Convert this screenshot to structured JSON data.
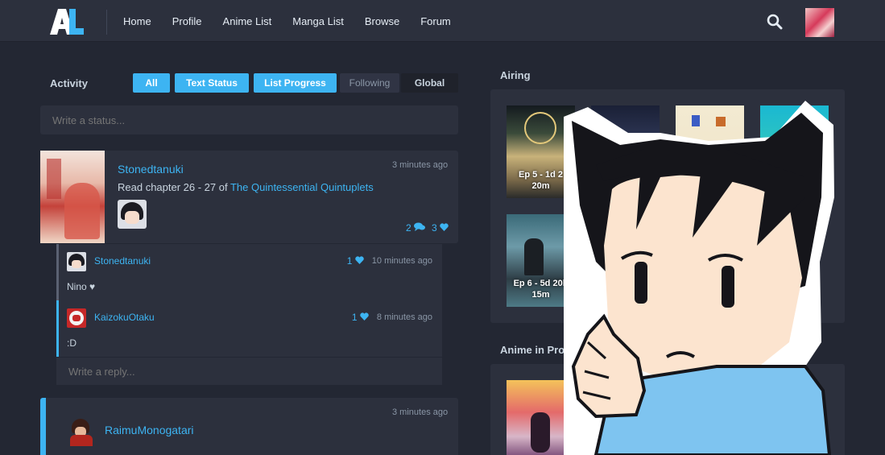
{
  "nav": {
    "logo_text": "AL",
    "links": [
      "Home",
      "Profile",
      "Anime List",
      "Manga List",
      "Browse",
      "Forum"
    ],
    "search_icon": "search-icon",
    "avatar_icon": "avatar"
  },
  "feed": {
    "title": "Activity",
    "filters": [
      "All",
      "Text Status",
      "List Progress",
      "Following",
      "Global"
    ],
    "status_placeholder": "Write a status...",
    "activity": {
      "user": "Stonedtanuki",
      "time": "3 minutes ago",
      "text_prefix": "Read chapter 26 - 27 of ",
      "media_title": "The Quintessential Quintuplets",
      "reply_count": "2",
      "like_count": "3"
    },
    "replies": [
      {
        "user": "Stonedtanuki",
        "likes": "1",
        "time": "10 minutes ago",
        "text": "Nino ♥"
      },
      {
        "user": "KaizokuOtaku",
        "likes": "1",
        "time": "8 minutes ago",
        "text": ":D"
      }
    ],
    "reply_placeholder": "Write a reply...",
    "activity2": {
      "user": "RaimuMonogatari",
      "time": "3 minutes ago"
    }
  },
  "sidebar": {
    "airing_title": "Airing",
    "airing": [
      {
        "ep": "Ep 5 - 1d 2",
        "time": "20m"
      },
      {
        "ep": "",
        "time": ""
      },
      {
        "ep": "",
        "time": ""
      },
      {
        "ep": "",
        "time": ""
      },
      {
        "ep": "Ep 6 - 5d 20h",
        "time": "15m"
      }
    ],
    "progress_title": "Anime in Progress"
  },
  "colors": {
    "accent": "#3db4f2",
    "background": "#232733",
    "panel": "#2c303d"
  }
}
